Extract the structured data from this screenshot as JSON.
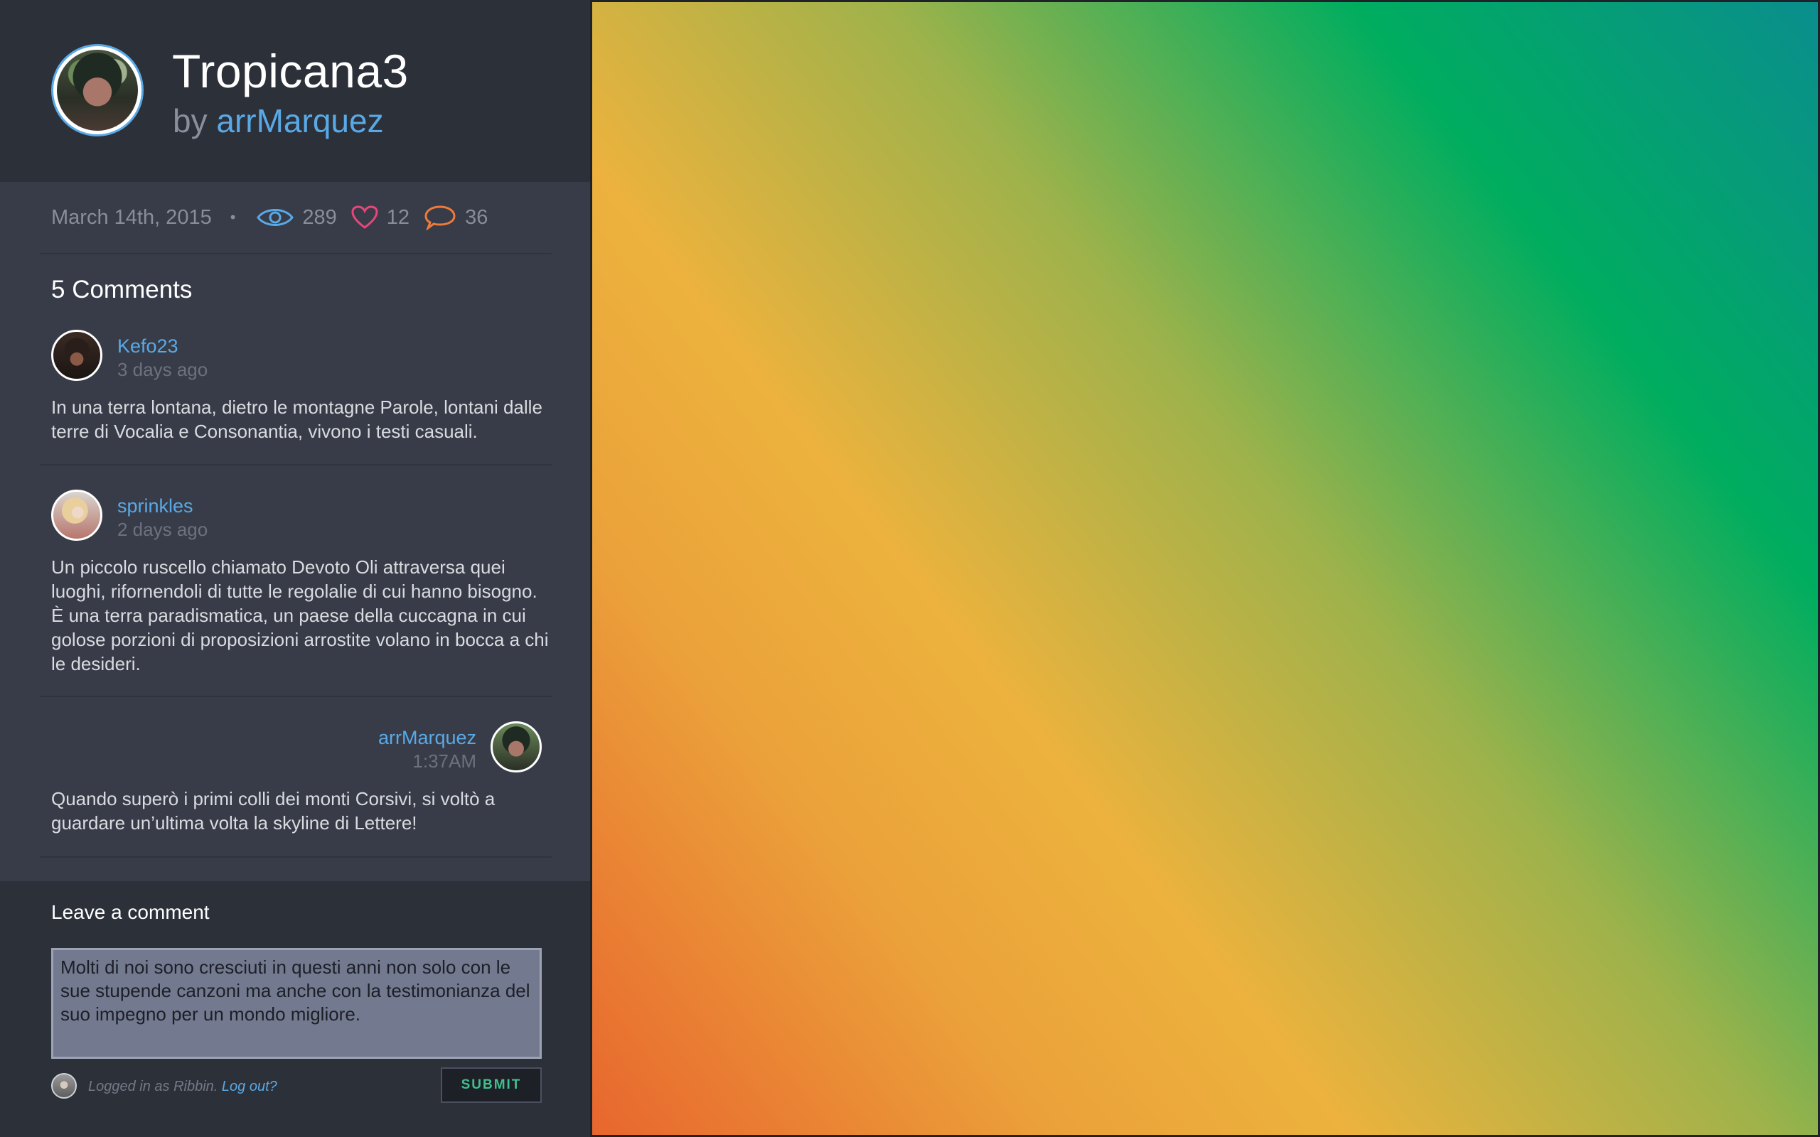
{
  "post": {
    "title": "Tropicana3",
    "by": "by",
    "author": "arrMarquez",
    "date": "March 14th, 2015",
    "separator": "•",
    "views": "289",
    "likes": "12",
    "comment_count": "36"
  },
  "icons": {
    "views": "eye-icon",
    "likes": "heart-icon",
    "comments": "speech-bubble-icon"
  },
  "colors": {
    "accent": "#59a9e6",
    "heart": "#e8457c",
    "bubble": "#f07a3a",
    "submit_text": "#3fc08e"
  },
  "comments": {
    "heading": "5 Comments",
    "items": [
      {
        "author": "Kefo23",
        "time": "3 days ago",
        "body": "In una terra lontana, dietro le montagne Parole, lontani dalle terre di Vocalia e Consonantia, vivono i testi casuali."
      },
      {
        "author": "sprinkles",
        "time": "2 days ago",
        "body": "Un piccolo ruscello chiamato Devoto Oli attraversa quei luoghi, rifornendoli di tutte le regolalie di cui hanno bisogno. È una terra paradismatica, un paese della cuccagna in cui golose porzioni di proposizioni arrostite volano in bocca a chi le desideri."
      },
      {
        "author": "arrMarquez",
        "time": "1:37AM",
        "body": "Quando superò i primi colli dei monti Corsivi, si voltò a guardare un’ultima volta la skyline di Lettere!"
      }
    ]
  },
  "form": {
    "label": "Leave a comment",
    "text": "Molti di noi sono cresciuti in questi anni non solo con le sue stupende canzoni ma anche con la testimonianza del suo impegno per un mondo migliore.",
    "logged_in": "Logged in as Ribbin.",
    "logout": "Log out?",
    "submit": "SUBMIT"
  }
}
